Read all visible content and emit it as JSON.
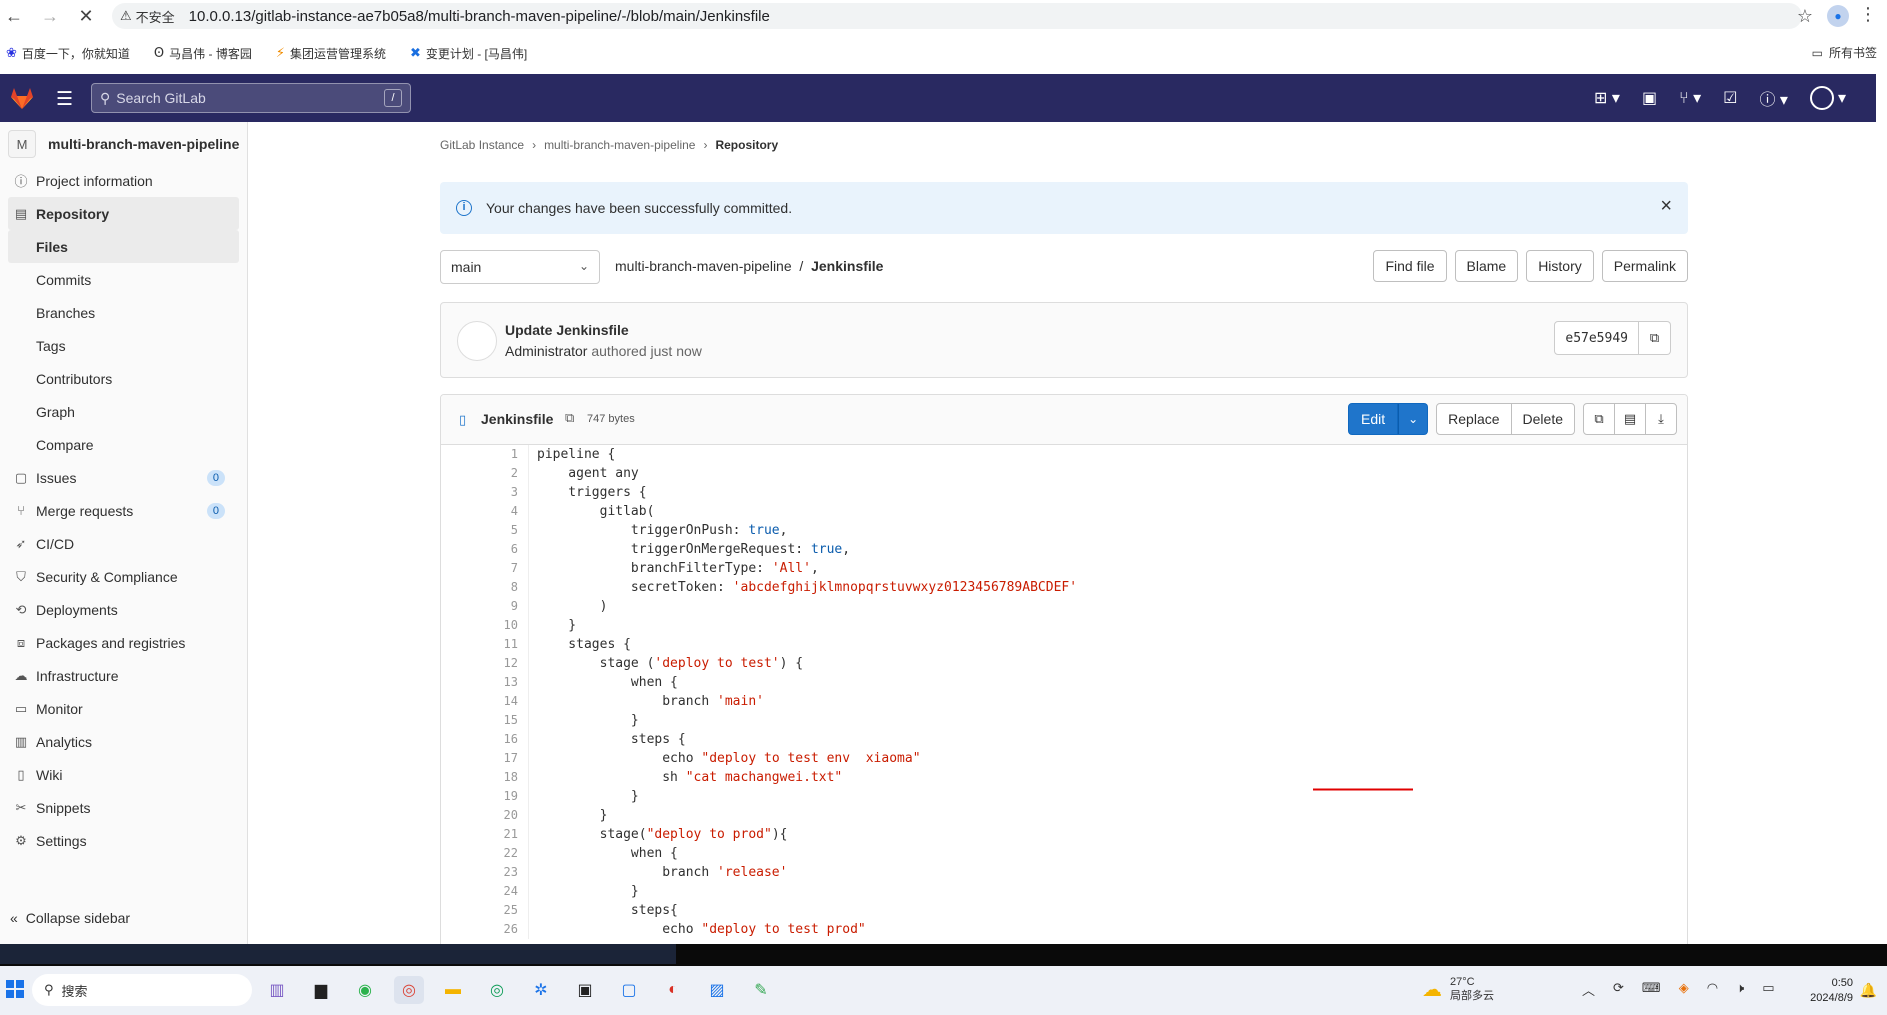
{
  "browser": {
    "insecure_label": "不安全",
    "url": "10.0.0.13/gitlab-instance-ae7b05a8/multi-branch-maven-pipeline/-/blob/main/Jenkinsfile",
    "bookmarks": [
      "百度一下，你就知道",
      "马昌伟 - 博客园",
      "集团运营管理系统",
      "变更计划 - [马昌伟]"
    ],
    "bookmarks_folder": "所有书签"
  },
  "header": {
    "search_placeholder": "Search GitLab",
    "search_shortcut": "/"
  },
  "sidebar": {
    "project_initial": "M",
    "project_name": "multi-branch-maven-pipeline",
    "items": [
      {
        "label": "Project information",
        "icon": "info-icon"
      },
      {
        "label": "Repository",
        "icon": "book-icon"
      },
      {
        "label": "Files"
      },
      {
        "label": "Commits"
      },
      {
        "label": "Branches"
      },
      {
        "label": "Tags"
      },
      {
        "label": "Contributors"
      },
      {
        "label": "Graph"
      },
      {
        "label": "Compare"
      },
      {
        "label": "Issues",
        "badge": "0"
      },
      {
        "label": "Merge requests",
        "badge": "0"
      },
      {
        "label": "CI/CD"
      },
      {
        "label": "Security & Compliance"
      },
      {
        "label": "Deployments"
      },
      {
        "label": "Packages and registries"
      },
      {
        "label": "Infrastructure"
      },
      {
        "label": "Monitor"
      },
      {
        "label": "Analytics"
      },
      {
        "label": "Wiki"
      },
      {
        "label": "Snippets"
      },
      {
        "label": "Settings"
      }
    ],
    "collapse_label": "Collapse sidebar"
  },
  "breadcrumb": [
    "GitLab Instance",
    "multi-branch-maven-pipeline",
    "Repository"
  ],
  "alert": {
    "message": "Your changes have been successfully committed."
  },
  "branch": {
    "selected": "main",
    "path_repo": "multi-branch-maven-pipeline",
    "path_file": "Jenkinsfile",
    "buttons": [
      "Find file",
      "Blame",
      "History",
      "Permalink"
    ]
  },
  "commit": {
    "title": "Update Jenkinsfile",
    "author": "Administrator",
    "authored": "authored just now",
    "sha": "e57e5949"
  },
  "file": {
    "name": "Jenkinsfile",
    "size": "747 bytes",
    "edit_label": "Edit",
    "replace_label": "Replace",
    "delete_label": "Delete"
  },
  "code_lines": [
    "pipeline {",
    "    agent any",
    "    triggers {",
    "        gitlab(",
    "            triggerOnPush: true,",
    "            triggerOnMergeRequest: true,",
    "            branchFilterType: 'All',",
    "            secretToken: 'abcdefghijklmnopqrstuvwxyz0123456789ABCDEF'",
    "        )",
    "    }",
    "    stages {",
    "        stage ('deploy to test') {",
    "            when {",
    "                branch 'main'",
    "            }",
    "            steps {",
    "                echo \"deploy to test env  xiaoma\"",
    "                sh \"cat machangwei.txt\"",
    "            }",
    "        }",
    "        stage(\"deploy to prod\"){",
    "            when {",
    "                branch 'release'",
    "            }",
    "            steps{",
    "                echo \"deploy to test prod\""
  ],
  "taskbar": {
    "search_label": "搜索",
    "weather_temp": "27°C",
    "weather_desc": "局部多云",
    "time": "0:50",
    "date": "2024/8/9"
  },
  "colors": {
    "header_bg": "#292961",
    "accent": "#1f75cb",
    "string": "#c91c00",
    "annotation": "#e00000"
  }
}
